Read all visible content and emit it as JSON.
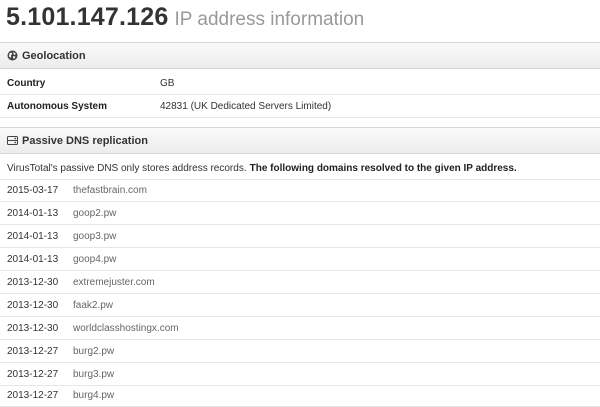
{
  "title": {
    "ip": "5.101.147.126",
    "subtitle": "IP address information"
  },
  "geolocation": {
    "header": "Geolocation",
    "icon": "globe-icon",
    "rows": [
      {
        "key": "Country",
        "value": "GB"
      },
      {
        "key": "Autonomous System",
        "value": "42831 (UK Dedicated Servers Limited)"
      }
    ]
  },
  "passive_dns": {
    "header": "Passive DNS replication",
    "icon": "storage-icon",
    "intro_text": "VirusTotal's passive DNS only stores address records.",
    "intro_bold": "The following domains resolved to the given IP address.",
    "rows": [
      {
        "date": "2015-03-17",
        "domain": "thefastbrain.com"
      },
      {
        "date": "2014-01-13",
        "domain": "goop2.pw"
      },
      {
        "date": "2014-01-13",
        "domain": "goop3.pw"
      },
      {
        "date": "2014-01-13",
        "domain": "goop4.pw"
      },
      {
        "date": "2013-12-30",
        "domain": "extremejuster.com"
      },
      {
        "date": "2013-12-30",
        "domain": "faak2.pw"
      },
      {
        "date": "2013-12-30",
        "domain": "worldclasshostingx.com"
      },
      {
        "date": "2013-12-27",
        "domain": "burg2.pw"
      },
      {
        "date": "2013-12-27",
        "domain": "burg3.pw"
      },
      {
        "date": "2013-12-27",
        "domain": "burg4.pw"
      }
    ]
  }
}
